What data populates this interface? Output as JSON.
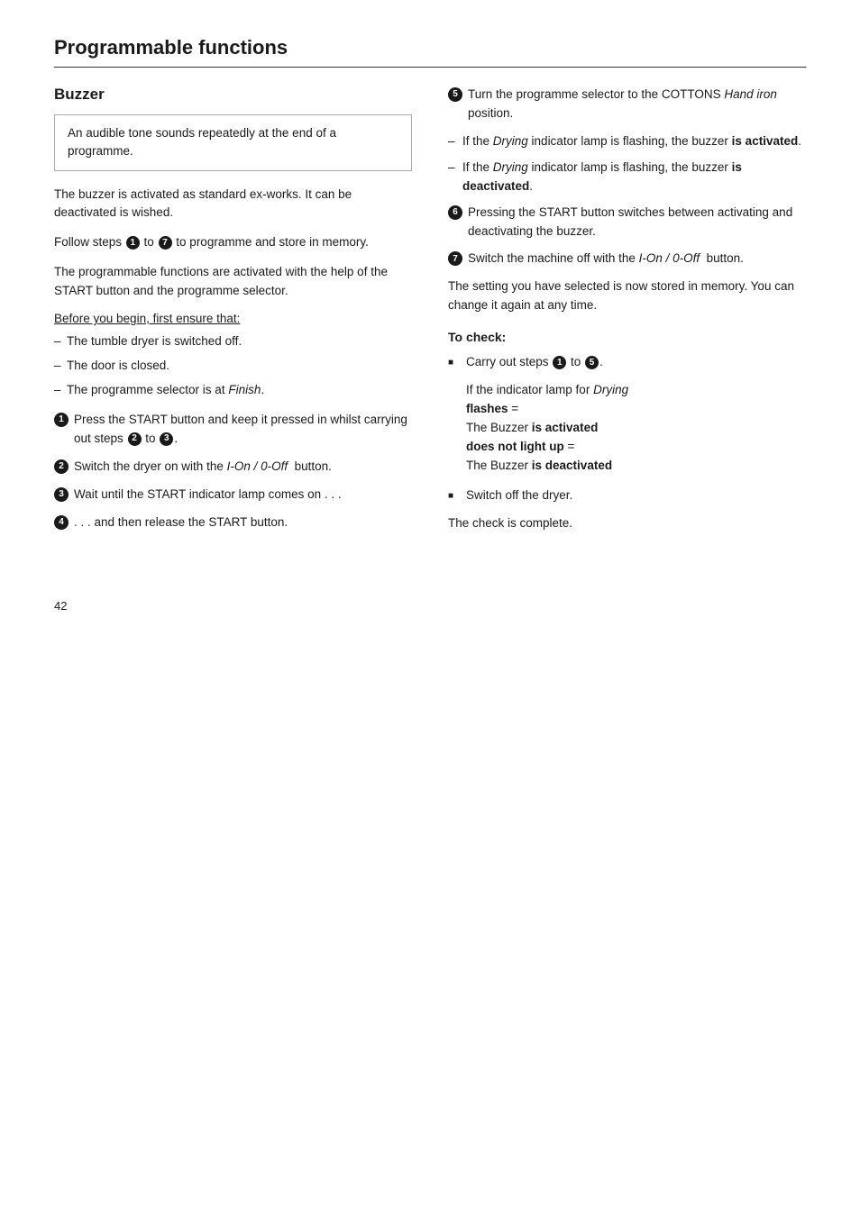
{
  "page": {
    "title": "Programmable functions",
    "page_number": "42"
  },
  "left_column": {
    "section_title": "Buzzer",
    "info_box": "An audible tone sounds repeatedly at the end of a programme.",
    "body_text_1": "The buzzer is activated as standard ex-works. It can be deactivated is wished.",
    "body_text_2": "Follow steps",
    "body_text_2b": "to",
    "body_text_2c": "to programme and store in memory.",
    "body_text_3": "The programmable functions are activated with the help of the START button and the programme selector.",
    "before_begin": "Before you begin, first ensure that:",
    "conditions": [
      "The tumble dryer is switched off.",
      "The door is closed.",
      "The programme selector is at Finish."
    ],
    "conditions_italic_index": 2,
    "steps": [
      {
        "number": "1",
        "text": "Press the START button and keep it pressed in whilst carrying out steps",
        "text2": "to",
        "step_ref_start": "2",
        "step_ref_end": "3"
      },
      {
        "number": "2",
        "text": "Switch the dryer on with the",
        "italic": "I-On / 0-Off",
        "text2": "button."
      },
      {
        "number": "3",
        "text": "Wait until the START indicator lamp comes on . . ."
      },
      {
        "number": "4",
        "text": ". . . and then release the START button."
      }
    ]
  },
  "right_column": {
    "steps": [
      {
        "number": "5",
        "text": "Turn the programme selector to the COTTONS",
        "italic": "Hand iron",
        "text2": "position."
      },
      {
        "number": "6",
        "text": "Pressing the START button switches between activating and deactivating the buzzer."
      },
      {
        "number": "7",
        "text": "Switch the machine off with the",
        "italic": "I-On / 0-Off",
        "text2": "button."
      }
    ],
    "dash_items": [
      {
        "text": "If the",
        "italic": "Drying",
        "text2": "indicator lamp is flashing, the buzzer",
        "bold": "is activated",
        "text3": "."
      },
      {
        "text": "If the",
        "italic": "Drying",
        "text2": "indicator lamp is flashing, the buzzer",
        "bold": "is deactivated",
        "text3": "."
      }
    ],
    "stored_text": "The setting you have selected is now stored in memory. You can change it again at any time.",
    "to_check_title": "To check:",
    "check_step1": "Carry out steps",
    "check_step1_from": "1",
    "check_step1_to": "5",
    "indicator_text_1": "If the indicator lamp for",
    "indicator_italic": "Drying",
    "indicator_text_2": "flashes =",
    "indicator_text_3": "The Buzzer",
    "indicator_bold_1": "is activated",
    "indicator_text_4": "does not light up =",
    "indicator_text_5": "The Buzzer",
    "indicator_bold_2": "is deactivated",
    "switch_off_dryer": "Switch off the dryer.",
    "check_complete": "The check is complete."
  }
}
